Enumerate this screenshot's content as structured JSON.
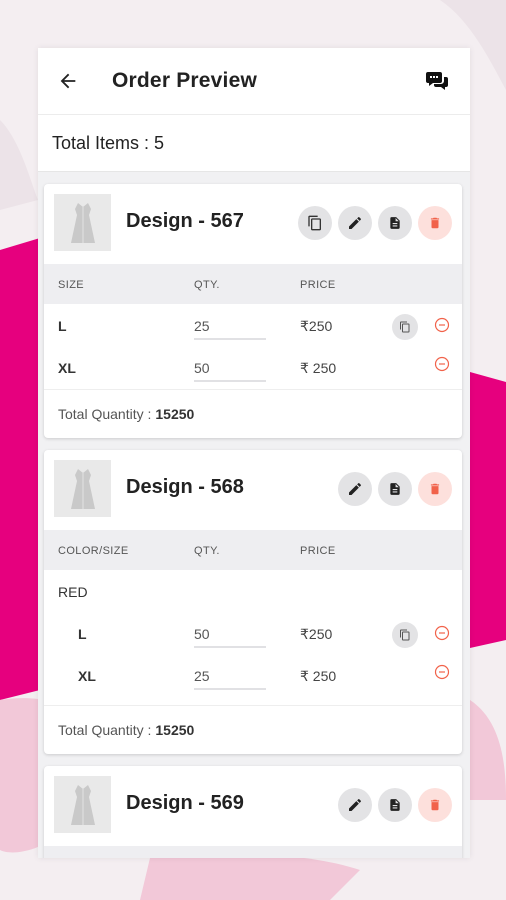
{
  "header": {
    "title": "Order Preview",
    "back_icon": "arrow-left-icon",
    "chat_icon": "chat-bubbles-icon"
  },
  "summary": {
    "total_items_label": "Total Items : 5"
  },
  "colors": {
    "accent_pink": "#e6007e",
    "delete_red": "#f1624a",
    "action_gray": "#e3e3e5"
  },
  "cards": [
    {
      "title": "Design - 567",
      "actions": [
        "copy-icon",
        "edit-icon",
        "document-icon",
        "delete-icon"
      ],
      "columns": [
        "SIZE",
        "QTY.",
        "PRICE"
      ],
      "rows": [
        {
          "label": "L",
          "qty": "25",
          "price": "₹250"
        },
        {
          "label": "XL",
          "qty": "50",
          "price": "₹ 250"
        }
      ],
      "total_label": "Total Quantity :",
      "total_value": "15250"
    },
    {
      "title": "Design - 568",
      "actions": [
        "edit-icon",
        "document-icon",
        "delete-icon"
      ],
      "columns": [
        "COLOR/SIZE",
        "QTY.",
        "PRICE"
      ],
      "color_label": "RED",
      "rows": [
        {
          "label": "L",
          "qty": "50",
          "price": "₹250"
        },
        {
          "label": "XL",
          "qty": "25",
          "price": "₹ 250"
        }
      ],
      "total_label": "Total Quantity :",
      "total_value": "15250"
    },
    {
      "title": "Design - 569",
      "actions": [
        "edit-icon",
        "document-icon",
        "delete-icon"
      ]
    }
  ]
}
